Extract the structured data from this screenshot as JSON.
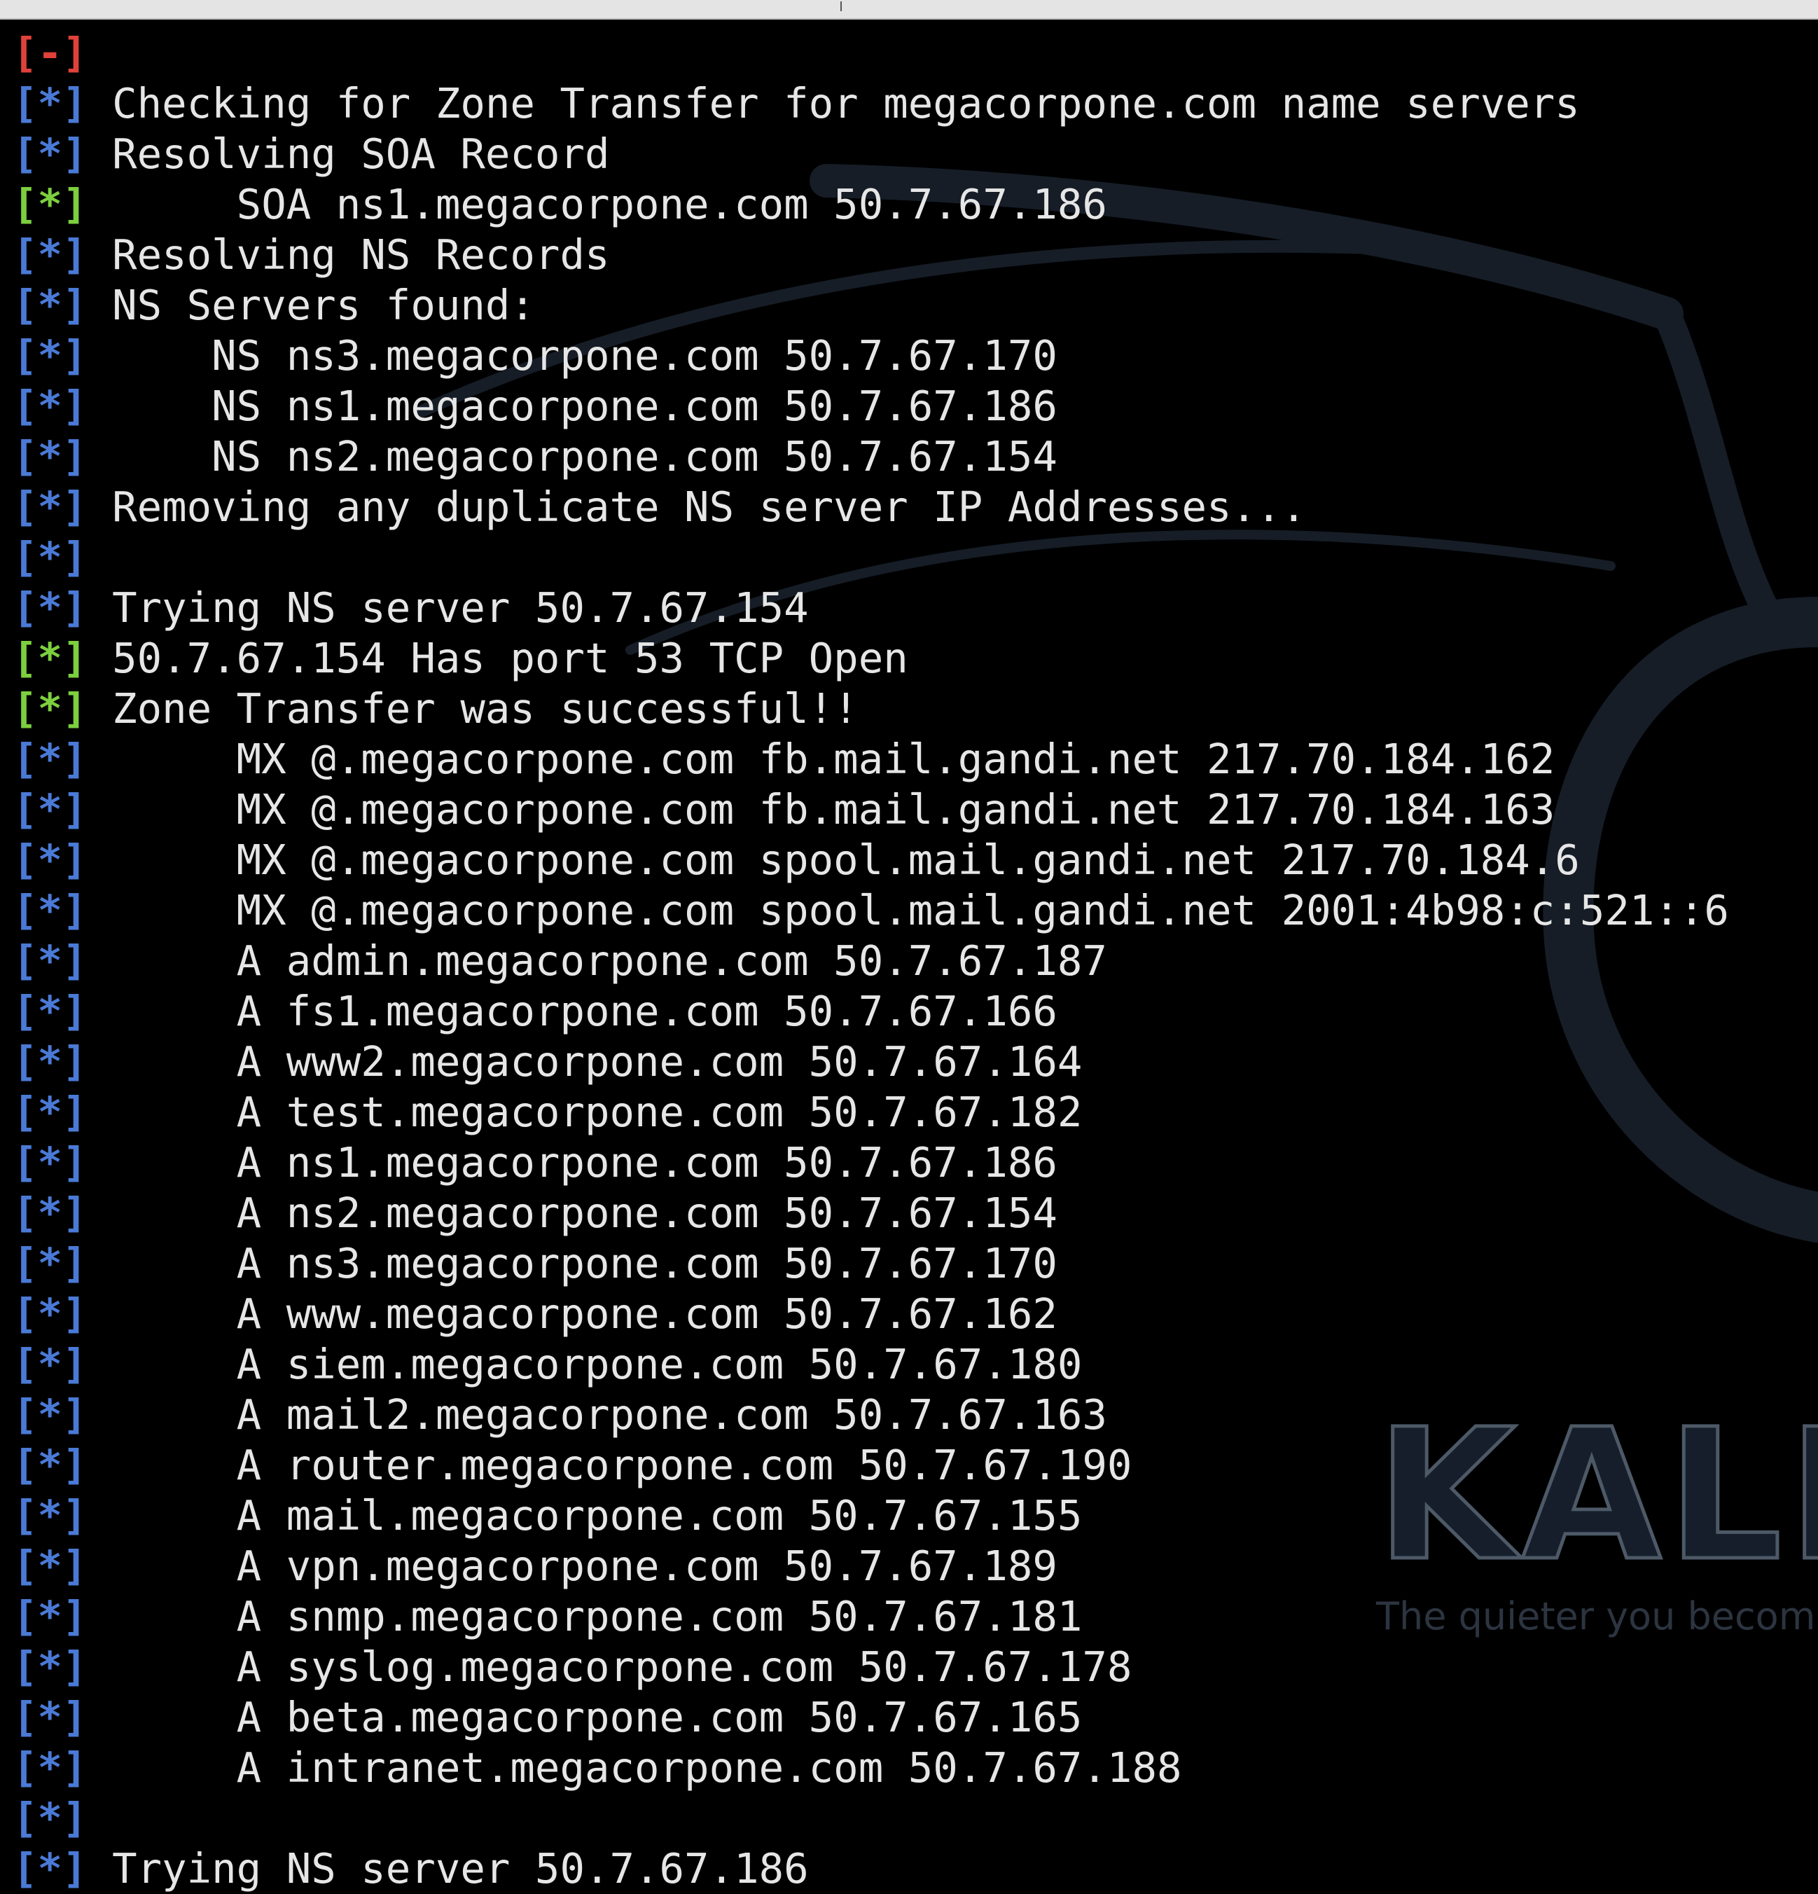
{
  "colors": {
    "background": "#000000",
    "text": "#e6e6e6",
    "prefix_info": "#4a7ad6",
    "prefix_success": "#7ccf3e",
    "prefix_error": "#e0413a"
  },
  "wallpaper": {
    "brand": "KALI",
    "tagline": "The quieter you becom"
  },
  "lines": [
    {
      "prefix": "[-]",
      "status": "error",
      "text": ""
    },
    {
      "prefix": "[*]",
      "status": "info",
      "text": "Checking for Zone Transfer for megacorpone.com name servers"
    },
    {
      "prefix": "[*]",
      "status": "info",
      "text": "Resolving SOA Record"
    },
    {
      "prefix": "[*]",
      "status": "success",
      "text": "     SOA ns1.megacorpone.com 50.7.67.186"
    },
    {
      "prefix": "[*]",
      "status": "info",
      "text": "Resolving NS Records"
    },
    {
      "prefix": "[*]",
      "status": "info",
      "text": "NS Servers found:"
    },
    {
      "prefix": "[*]",
      "status": "info",
      "text": "    NS ns3.megacorpone.com 50.7.67.170"
    },
    {
      "prefix": "[*]",
      "status": "info",
      "text": "    NS ns1.megacorpone.com 50.7.67.186"
    },
    {
      "prefix": "[*]",
      "status": "info",
      "text": "    NS ns2.megacorpone.com 50.7.67.154"
    },
    {
      "prefix": "[*]",
      "status": "info",
      "text": "Removing any duplicate NS server IP Addresses..."
    },
    {
      "prefix": "[*]",
      "status": "info",
      "text": ""
    },
    {
      "prefix": "[*]",
      "status": "info",
      "text": "Trying NS server 50.7.67.154"
    },
    {
      "prefix": "[*]",
      "status": "success",
      "text": "50.7.67.154 Has port 53 TCP Open"
    },
    {
      "prefix": "[*]",
      "status": "success",
      "text": "Zone Transfer was successful!!"
    },
    {
      "prefix": "[*]",
      "status": "info",
      "text": "     MX @.megacorpone.com fb.mail.gandi.net 217.70.184.162"
    },
    {
      "prefix": "[*]",
      "status": "info",
      "text": "     MX @.megacorpone.com fb.mail.gandi.net 217.70.184.163"
    },
    {
      "prefix": "[*]",
      "status": "info",
      "text": "     MX @.megacorpone.com spool.mail.gandi.net 217.70.184.6"
    },
    {
      "prefix": "[*]",
      "status": "info",
      "text": "     MX @.megacorpone.com spool.mail.gandi.net 2001:4b98:c:521::6"
    },
    {
      "prefix": "[*]",
      "status": "info",
      "text": "     A admin.megacorpone.com 50.7.67.187"
    },
    {
      "prefix": "[*]",
      "status": "info",
      "text": "     A fs1.megacorpone.com 50.7.67.166"
    },
    {
      "prefix": "[*]",
      "status": "info",
      "text": "     A www2.megacorpone.com 50.7.67.164"
    },
    {
      "prefix": "[*]",
      "status": "info",
      "text": "     A test.megacorpone.com 50.7.67.182"
    },
    {
      "prefix": "[*]",
      "status": "info",
      "text": "     A ns1.megacorpone.com 50.7.67.186"
    },
    {
      "prefix": "[*]",
      "status": "info",
      "text": "     A ns2.megacorpone.com 50.7.67.154"
    },
    {
      "prefix": "[*]",
      "status": "info",
      "text": "     A ns3.megacorpone.com 50.7.67.170"
    },
    {
      "prefix": "[*]",
      "status": "info",
      "text": "     A www.megacorpone.com 50.7.67.162"
    },
    {
      "prefix": "[*]",
      "status": "info",
      "text": "     A siem.megacorpone.com 50.7.67.180"
    },
    {
      "prefix": "[*]",
      "status": "info",
      "text": "     A mail2.megacorpone.com 50.7.67.163"
    },
    {
      "prefix": "[*]",
      "status": "info",
      "text": "     A router.megacorpone.com 50.7.67.190"
    },
    {
      "prefix": "[*]",
      "status": "info",
      "text": "     A mail.megacorpone.com 50.7.67.155"
    },
    {
      "prefix": "[*]",
      "status": "info",
      "text": "     A vpn.megacorpone.com 50.7.67.189"
    },
    {
      "prefix": "[*]",
      "status": "info",
      "text": "     A snmp.megacorpone.com 50.7.67.181"
    },
    {
      "prefix": "[*]",
      "status": "info",
      "text": "     A syslog.megacorpone.com 50.7.67.178"
    },
    {
      "prefix": "[*]",
      "status": "info",
      "text": "     A beta.megacorpone.com 50.7.67.165"
    },
    {
      "prefix": "[*]",
      "status": "info",
      "text": "     A intranet.megacorpone.com 50.7.67.188"
    },
    {
      "prefix": "[*]",
      "status": "info",
      "text": ""
    },
    {
      "prefix": "[*]",
      "status": "info",
      "text": "Trying NS server 50.7.67.186"
    }
  ]
}
